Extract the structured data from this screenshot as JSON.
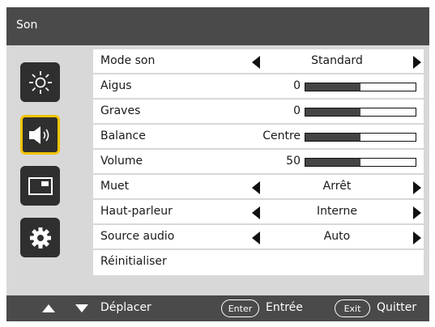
{
  "header": {
    "title": "Son"
  },
  "sidebar": {
    "tabs": [
      {
        "icon": "brightness-icon",
        "active": false
      },
      {
        "icon": "speaker-icon",
        "active": true
      },
      {
        "icon": "picture-in-picture-icon",
        "active": false
      },
      {
        "icon": "gear-icon",
        "active": false
      }
    ]
  },
  "menu": {
    "rows": [
      {
        "label": "Mode son",
        "type": "option",
        "value": "Standard"
      },
      {
        "label": "Aigus",
        "type": "slider",
        "value": "0",
        "fill_fraction": 0.5
      },
      {
        "label": "Graves",
        "type": "slider",
        "value": "0",
        "fill_fraction": 0.5
      },
      {
        "label": "Balance",
        "type": "slider",
        "value": "Centre",
        "fill_fraction": 0.5
      },
      {
        "label": "Volume",
        "type": "slider",
        "value": "50",
        "fill_fraction": 0.5
      },
      {
        "label": "Muet",
        "type": "option",
        "value": "Arrêt"
      },
      {
        "label": "Haut-parleur",
        "type": "option",
        "value": "Interne"
      },
      {
        "label": "Source audio",
        "type": "option",
        "value": "Auto"
      },
      {
        "label": "Réinitialiser",
        "type": "action"
      }
    ]
  },
  "footer": {
    "move_label": "Déplacer",
    "enter_key": "Enter",
    "enter_label": "Entrée",
    "exit_key": "Exit",
    "exit_label": "Quitter"
  },
  "colors": {
    "accent": "#f2c300",
    "panel": "#4a4a4a"
  }
}
